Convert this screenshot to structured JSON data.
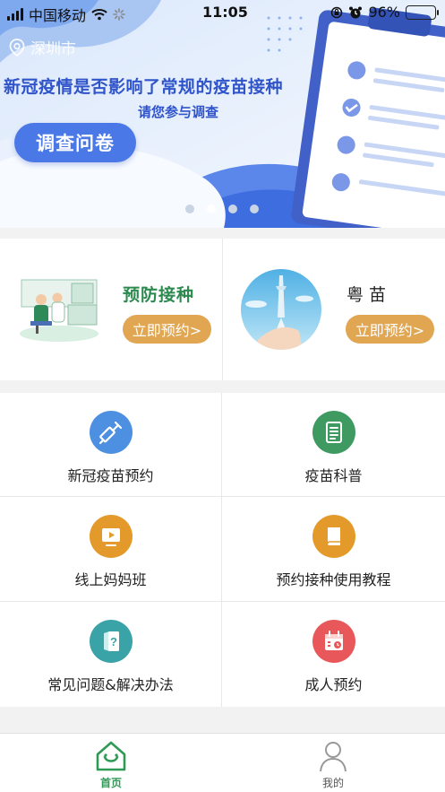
{
  "status_bar": {
    "carrier": "中国移动",
    "time": "11:05",
    "battery_percent": "96%",
    "battery_level": 0.96
  },
  "banner": {
    "location": "深圳市",
    "title": "新冠疫情是否影响了常规的疫苗接种",
    "subtitle": "请您参与调查",
    "button_label": "调查问卷",
    "slide_count": 4,
    "active_slide": 2
  },
  "cards": [
    {
      "title": "预防接种",
      "button_label": "立即预约>"
    },
    {
      "title": "粤苗",
      "button_label": "立即预约>"
    }
  ],
  "services": [
    {
      "label": "新冠疫苗预约",
      "icon": "syringe-icon",
      "color": "#4d8fe0"
    },
    {
      "label": "疫苗科普",
      "icon": "document-icon",
      "color": "#3f9a62"
    },
    {
      "label": "线上妈妈班",
      "icon": "video-play-icon",
      "color": "#e39a2a"
    },
    {
      "label": "预约接种使用教程",
      "icon": "book-icon",
      "color": "#e39a2a"
    },
    {
      "label": "常见问题&解决办法",
      "icon": "question-book-icon",
      "color": "#3aa3a8"
    },
    {
      "label": "成人预约",
      "icon": "calendar-icon",
      "color": "#e8585a"
    }
  ],
  "tabbar": {
    "tabs": [
      {
        "label": "首页",
        "icon": "home-icon",
        "active": true
      },
      {
        "label": "我的",
        "icon": "user-icon",
        "active": false
      }
    ]
  },
  "colors": {
    "brand_green": "#2e9a55",
    "banner_blue": "#3054c9",
    "button_orange": "#e0a652"
  }
}
